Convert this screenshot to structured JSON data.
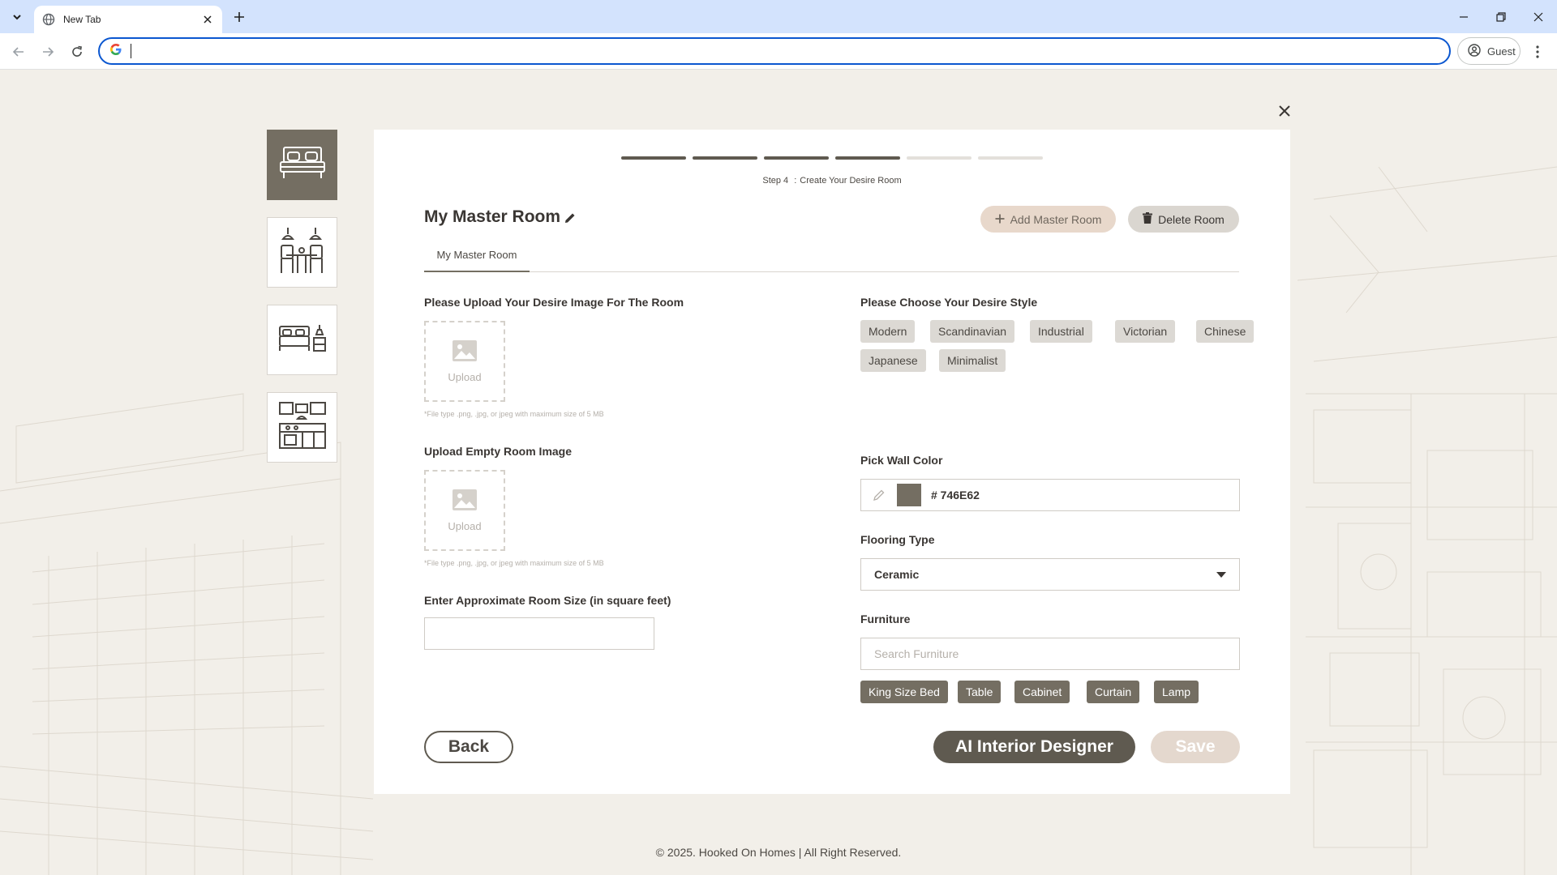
{
  "browser": {
    "tab_title": "New Tab",
    "omnibox_value": "",
    "profile_label": "Guest"
  },
  "progress": {
    "total_steps": 6,
    "completed_steps": 4,
    "step_number": "Step 4",
    "step_separator": ":",
    "step_title": "Create Your Desire Room"
  },
  "room_thumbnails": [
    {
      "icon": "bedroom-icon",
      "active": true
    },
    {
      "icon": "dining-room-icon",
      "active": false
    },
    {
      "icon": "bedroom-nightstand-icon",
      "active": false
    },
    {
      "icon": "kitchen-icon",
      "active": false
    }
  ],
  "room": {
    "title": "My Master Room",
    "tab_label": "My Master Room",
    "add_button": "Add Master Room",
    "delete_button": "Delete Room"
  },
  "left_form": {
    "desire_image_label": "Please Upload Your Desire Image For The Room",
    "upload_text": "Upload",
    "file_hint": "*File type .png, .jpg, or jpeg with maximum size of 5 MB",
    "empty_room_label": "Upload Empty Room Image",
    "room_size_label": "Enter Approximate Room Size (in square feet)",
    "room_size_value": ""
  },
  "right_form": {
    "style_label": "Please Choose Your Desire Style",
    "styles": [
      "Modern",
      "Scandinavian",
      "Industrial",
      "Victorian",
      "Chinese",
      "Japanese",
      "Minimalist"
    ],
    "wall_color_label": "Pick Wall Color",
    "wall_color_value": "# 746E62",
    "wall_color_hex": "#746E62",
    "flooring_label": "Flooring Type",
    "flooring_value": "Ceramic",
    "furniture_label": "Furniture",
    "furniture_placeholder": "Search Furniture",
    "furniture_selected": [
      "King Size Bed",
      "Table",
      "Cabinet",
      "Curtain",
      "Lamp"
    ]
  },
  "actions": {
    "back": "Back",
    "ai_designer": "AI Interior Designer",
    "save": "Save"
  },
  "footer": "© 2025. Hooked On Homes | All Right Reserved.",
  "colors": {
    "brand_dark": "#5F5A50",
    "brand_mid": "#746E62",
    "accent_light": "#E8D8CB",
    "omnibox_focus": "#0B57D0"
  }
}
